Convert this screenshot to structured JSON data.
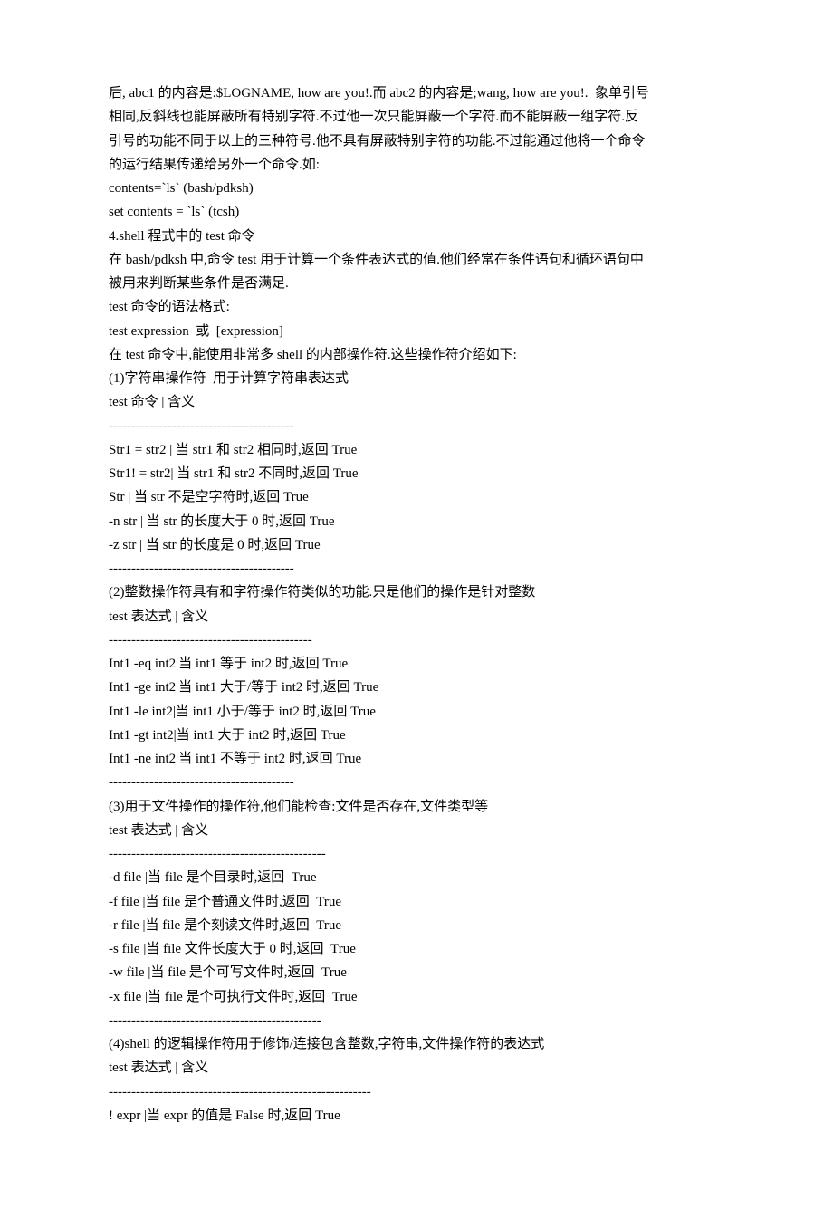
{
  "lines": [
    "后, abc1 的内容是:$LOGNAME, how are you!.而 abc2 的内容是;wang, how are you!.  象单引号",
    "相同,反斜线也能屏蔽所有特别字符.不过他一次只能屏蔽一个字符.而不能屏蔽一组字符.反",
    "引号的功能不同于以上的三种符号.他不具有屏蔽特别字符的功能.不过能通过他将一个命令",
    "的运行结果传递给另外一个命令.如:",
    "contents=`ls` (bash/pdksh)",
    "set contents = `ls` (tcsh)",
    "4.shell 程式中的 test 命令",
    "在 bash/pdksh 中,命令 test 用于计算一个条件表达式的值.他们经常在条件语句和循环语句中",
    "被用来判断某些条件是否满足.",
    "test 命令的语法格式:",
    "test expression  或  [expression]",
    "在 test 命令中,能使用非常多 shell 的内部操作符.这些操作符介绍如下:",
    "(1)字符串操作符  用于计算字符串表达式",
    "test 命令 | 含义",
    "-----------------------------------------",
    "Str1 = str2 | 当 str1 和 str2 相同时,返回 True",
    "Str1! = str2| 当 str1 和 str2 不同时,返回 True",
    "Str | 当 str 不是空字符时,返回 True",
    "-n str | 当 str 的长度大于 0 时,返回 True",
    "-z str | 当 str 的长度是 0 时,返回 True",
    "-----------------------------------------",
    "(2)整数操作符具有和字符操作符类似的功能.只是他们的操作是针对整数",
    "test 表达式 | 含义",
    "---------------------------------------------",
    "Int1 -eq int2|当 int1 等于 int2 时,返回 True",
    "Int1 -ge int2|当 int1 大于/等于 int2 时,返回 True",
    "Int1 -le int2|当 int1 小于/等于 int2 时,返回 True",
    "Int1 -gt int2|当 int1 大于 int2 时,返回 True",
    "Int1 -ne int2|当 int1 不等于 int2 时,返回 True",
    "-----------------------------------------",
    "(3)用于文件操作的操作符,他们能检查:文件是否存在,文件类型等",
    "test 表达式 | 含义",
    "------------------------------------------------",
    "-d file |当 file 是个目录时,返回  True",
    "-f file |当 file 是个普通文件时,返回  True",
    "-r file |当 file 是个刻读文件时,返回  True",
    "-s file |当 file 文件长度大于 0 时,返回  True",
    "-w file |当 file 是个可写文件时,返回  True",
    "-x file |当 file 是个可执行文件时,返回  True",
    "-----------------------------------------------",
    "(4)shell 的逻辑操作符用于修饰/连接包含整数,字符串,文件操作符的表达式",
    "test 表达式 | 含义",
    "----------------------------------------------------------",
    "! expr |当 expr 的值是 False 时,返回 True"
  ]
}
